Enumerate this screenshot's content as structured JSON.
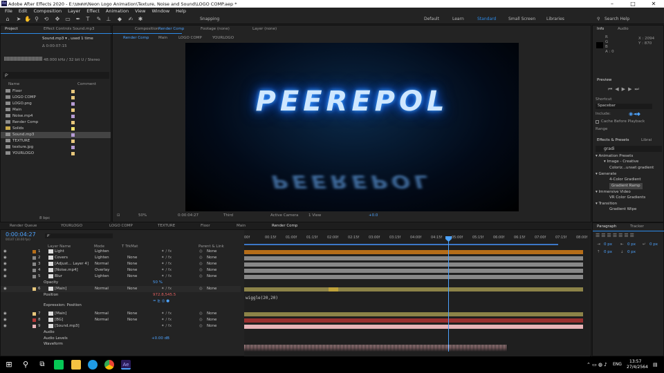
{
  "title": "Adobe After Effects 2020 - E:\\นพดล\\Neon Logo Animation\\Texture, Noise and Sound\\LOGO COMP.aep *",
  "menu": [
    "File",
    "Edit",
    "Composition",
    "Layer",
    "Effect",
    "Animation",
    "View",
    "Window",
    "Help"
  ],
  "toolbar": {
    "snapping": "Snapping",
    "workspaces": [
      "Default",
      "Learn",
      "Standard",
      "Small Screen",
      "Libraries"
    ],
    "search": "Search Help"
  },
  "project": {
    "tab": "Project",
    "effect_tab": "Effect Controls Sound.mp3",
    "item": "Sound.mp3 ▾ , used 1 time",
    "duration": "Δ 0:00:07:15",
    "audio": "48.000 kHz / 32 bit U / Stereo",
    "search": "ρ‧",
    "col_name": "Name",
    "col_comment": "Comment",
    "items": [
      "Floor",
      "LOGO COMP",
      "LOGO.png",
      "Main",
      "Noise.mp4",
      "Render Comp",
      "Solids",
      "Sound.mp3",
      "TEXTURE",
      "texture.jpg",
      "YOURLOGO"
    ],
    "bpc": "8 bpc"
  },
  "comp": {
    "tab": "Composition",
    "tab_name": "Render Comp",
    "footage": "Footage (none)",
    "layer": "Layer (none)",
    "crumbs": [
      "Render Comp",
      "Main",
      "LOGO COMP",
      "YOURLOGO"
    ],
    "logo": "PEEREPOL",
    "zoom": "50%",
    "timecode": "0:00:04:27",
    "res": "Third",
    "camera": "Active Camera",
    "view": "1 View",
    "exposure": "+0.0"
  },
  "info": {
    "tab": "Info",
    "audio": "Audio",
    "R": "R",
    "G": "G",
    "B": "B",
    "A": "A : 0",
    "X": "X : 2094",
    "Y": "Y : 870"
  },
  "preview": {
    "tab": "Preview",
    "shortcut": "Shortcut",
    "spacebar": "Spacebar",
    "include": "Include:",
    "cache": "Cache Before Playback",
    "range": "Range"
  },
  "effects": {
    "tab": "Effects & Presets",
    "tab2": "Librai",
    "search": "gradi",
    "items": [
      "▾ Animation Presets",
      "▾ Image - Creative",
      "Coloriz...unset gradient",
      "▾ Generate",
      "4-Color Gradient",
      "Gradient Ramp",
      "▾ Immersive Video",
      "VR Color Gradients",
      "▾ Transition",
      "Gradient Wipe"
    ]
  },
  "tl_tabs": [
    "Render Queue",
    "YOURLOGO",
    "LOGO COMP",
    "TEXTURE",
    "Floor",
    "Main",
    "Render Comp"
  ],
  "timeline": {
    "timecode": "0:00:04:27",
    "fps": "00147 (30.00 fps)",
    "search": "ρ‧",
    "hdr": [
      "Layer Name",
      "Mode",
      "T TrkMat",
      "Parent & Link"
    ],
    "ticks": [
      "00f",
      "00:15f",
      "01:00f",
      "01:15f",
      "02:00f",
      "02:15f",
      "03:00f",
      "03:15f",
      "04:00f",
      "04:15f",
      "05:00f",
      "05:15f",
      "06:00f",
      "06:15f",
      "07:00f",
      "07:15f",
      "08:00f"
    ],
    "layers": [
      {
        "n": "1",
        "name": "Light",
        "mode": "Lighten",
        "trk": "",
        "parent": "None"
      },
      {
        "n": "2",
        "name": "Covers",
        "mode": "Lighten",
        "trk": "None",
        "parent": "None"
      },
      {
        "n": "3",
        "name": "[Adjust... Layer 4]",
        "mode": "Normal",
        "trk": "None",
        "parent": "None"
      },
      {
        "n": "4",
        "name": "[Noise.mp4]",
        "mode": "Overlay",
        "trk": "None",
        "parent": "None"
      },
      {
        "n": "5",
        "name": "Blur",
        "mode": "Lighten",
        "trk": "None",
        "parent": "None"
      },
      {
        "n": "",
        "name": "Opacity",
        "mode": "",
        "trk": "50 %",
        "parent": ""
      },
      {
        "n": "6",
        "name": "[Main]",
        "mode": "Normal",
        "trk": "None",
        "parent": "None"
      },
      {
        "n": "",
        "name": "Position",
        "mode": "",
        "trk": "972.8,545.5",
        "parent": ""
      },
      {
        "n": "",
        "name": "",
        "mode": "",
        "trk": "= ⊵ ◎ ●",
        "parent": ""
      },
      {
        "n": "",
        "name": "Expression: Position",
        "mode": "",
        "trk": "",
        "parent": ""
      },
      {
        "n": "7",
        "name": "[Main]",
        "mode": "Normal",
        "trk": "None",
        "parent": "None"
      },
      {
        "n": "8",
        "name": "[BG]",
        "mode": "Normal",
        "trk": "None",
        "parent": "None"
      },
      {
        "n": "9",
        "name": "[Sound.mp3]",
        "mode": "",
        "trk": "",
        "parent": "None"
      },
      {
        "n": "",
        "name": "Audio",
        "mode": "",
        "trk": "",
        "parent": ""
      },
      {
        "n": "",
        "name": "Audio Levels",
        "mode": "",
        "trk": "+0.00 dB",
        "parent": ""
      },
      {
        "n": "",
        "name": "Waveform",
        "mode": "",
        "trk": "",
        "parent": ""
      }
    ],
    "expression": "wiggle(20,20)"
  },
  "paragraph": {
    "tab": "Paragraph",
    "tab2": "Tracker",
    "v1": "0 px",
    "v2": "0 px",
    "v3": "0 px",
    "v4": "0 px",
    "v5": "0 px"
  },
  "taskbar": {
    "lang": "ENG",
    "time": "13:57",
    "date": "27/4/2564"
  },
  "colors": {
    "accent": "#2d8ceb",
    "layer_tan": "#e7c77c",
    "layer_orange": "#b56d19",
    "layer_gray": "#888888",
    "layer_red": "#b53838",
    "layer_pink": "#e8b4b8"
  }
}
